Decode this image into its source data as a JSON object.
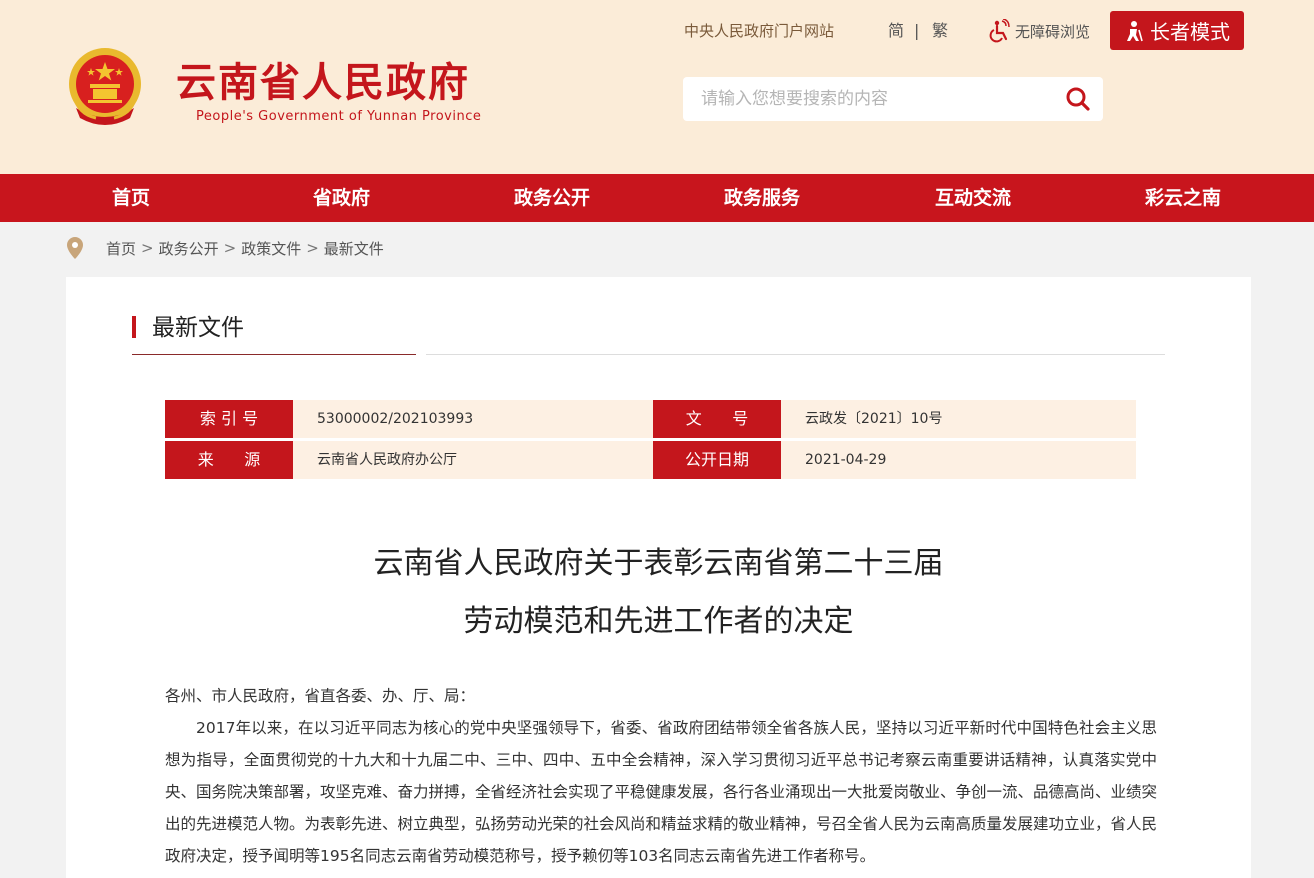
{
  "header": {
    "site_title": "云南省人民政府",
    "site_subtitle": "People's Government of Yunnan Province",
    "portal_link": "中央人民政府门户网站",
    "lang_simplified": "简",
    "lang_separator": "|",
    "lang_traditional": "繁",
    "accessibility": "无障碍浏览",
    "elder_mode": "长者模式",
    "search_placeholder": "请输入您想要搜索的内容",
    "colors": {
      "brand": "#c4161c",
      "header_bg": "#fbecd8"
    }
  },
  "nav": {
    "items": [
      {
        "label": "首页"
      },
      {
        "label": "省政府"
      },
      {
        "label": "政务公开"
      },
      {
        "label": "政务服务"
      },
      {
        "label": "互动交流"
      },
      {
        "label": "彩云之南"
      }
    ]
  },
  "breadcrumb": {
    "icon": "location-pin-icon",
    "items": [
      "首页",
      "政务公开",
      "政策文件",
      "最新文件"
    ],
    "separator": ">"
  },
  "section": {
    "title": "最新文件"
  },
  "meta": {
    "index_label": "索 引 号",
    "index_value": "53000002/202103993",
    "docno_label": "文      号",
    "docno_value": "云政发〔2021〕10号",
    "source_label": "来      源",
    "source_value": "云南省人民政府办公厅",
    "date_label": "公开日期",
    "date_value": "2021-04-29"
  },
  "document": {
    "title_line1": "云南省人民政府关于表彰云南省第二十三届",
    "title_line2": "劳动模范和先进工作者的决定",
    "salutation": "各州、市人民政府，省直各委、办、厅、局：",
    "paragraph1": "2017年以来，在以习近平同志为核心的党中央坚强领导下，省委、省政府团结带领全省各族人民，坚持以习近平新时代中国特色社会主义思想为指导，全面贯彻党的十九大和十九届二中、三中、四中、五中全会精神，深入学习贯彻习近平总书记考察云南重要讲话精神，认真落实党中央、国务院决策部署，攻坚克难、奋力拼搏，全省经济社会实现了平稳健康发展，各行各业涌现出一大批爱岗敬业、争创一流、品德高尚、业绩突出的先进模范人物。为表彰先进、树立典型，弘扬劳动光荣的社会风尚和精益求精的敬业精神，号召全省人民为云南高质量发展建功立业，省人民政府决定，授予闻明等195名同志云南省劳动模范称号，授予赖仞等103名同志云南省先进工作者称号。"
  }
}
